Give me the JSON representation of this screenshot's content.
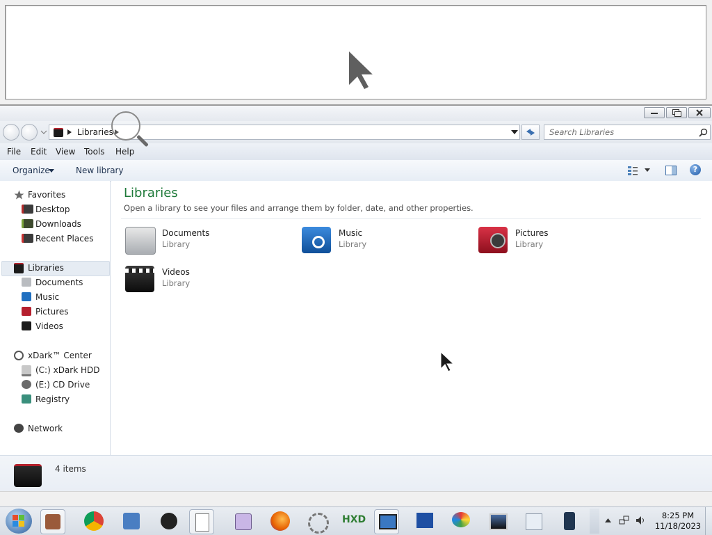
{
  "window": {
    "address_crumb": "Libraries",
    "search_placeholder": "Search Libraries"
  },
  "menu": [
    "File",
    "Edit",
    "View",
    "Tools",
    "Help"
  ],
  "commands": {
    "organize": "Organize",
    "new_library": "New library"
  },
  "nav": {
    "favorites": {
      "label": "Favorites",
      "items": [
        "Desktop",
        "Downloads",
        "Recent Places"
      ]
    },
    "libraries": {
      "label": "Libraries",
      "items": [
        "Documents",
        "Music",
        "Pictures",
        "Videos"
      ]
    },
    "computer": {
      "label": "xDark™ Center",
      "items": [
        "(C:) xDark HDD",
        "(E:) CD Drive",
        "Registry"
      ]
    },
    "network": {
      "label": "Network"
    }
  },
  "content": {
    "title": "Libraries",
    "subtitle": "Open a library to see your files and arrange them by folder, date, and other properties.",
    "libraries": [
      {
        "name": "Documents",
        "type": "Library",
        "icon": "documents-library-icon"
      },
      {
        "name": "Music",
        "type": "Library",
        "icon": "music-library-icon"
      },
      {
        "name": "Pictures",
        "type": "Library",
        "icon": "pictures-library-icon"
      },
      {
        "name": "Videos",
        "type": "Library",
        "icon": "videos-library-icon"
      }
    ]
  },
  "details": {
    "item_count": "4 items"
  },
  "clock": {
    "time": "8:25 PM",
    "date": "11/18/2023"
  }
}
